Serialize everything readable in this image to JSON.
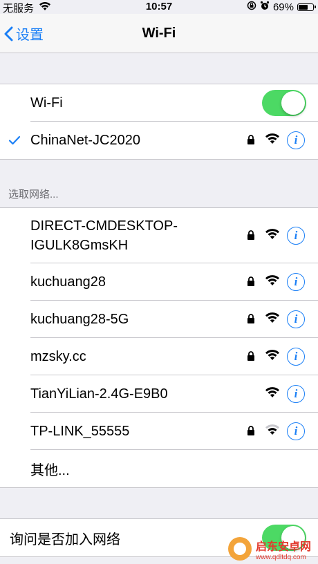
{
  "status_bar": {
    "carrier": "无服务",
    "time": "10:57",
    "battery": "69%",
    "battery_level": 0.69
  },
  "nav": {
    "back_label": "设置",
    "title": "Wi-Fi"
  },
  "wifi_toggle": {
    "label": "Wi-Fi",
    "on": true
  },
  "connected": {
    "name": "ChinaNet-JC2020",
    "locked": true
  },
  "section_header": "选取网络...",
  "networks": [
    {
      "name_line1": "DIRECT-CMDESKTOP-",
      "name_line2": "IGULK8GmsKH",
      "locked": true,
      "signal": "full"
    },
    {
      "name": "kuchuang28",
      "locked": true,
      "signal": "full"
    },
    {
      "name": "kuchuang28-5G",
      "locked": true,
      "signal": "full"
    },
    {
      "name": "mzsky.cc",
      "locked": true,
      "signal": "full"
    },
    {
      "name": "TianYiLian-2.4G-E9B0",
      "locked": false,
      "signal": "full"
    },
    {
      "name": "TP-LINK_55555",
      "locked": true,
      "signal": "weak"
    }
  ],
  "other_label": "其他...",
  "ask_to_join": {
    "label": "询问是否加入网络",
    "on": true
  },
  "watermark": {
    "name": "启东安卓网",
    "url": "www.qdltdq.com"
  },
  "colors": {
    "accent": "#1a7ff6",
    "toggle_on": "#4cd964",
    "background": "#efeff4"
  }
}
